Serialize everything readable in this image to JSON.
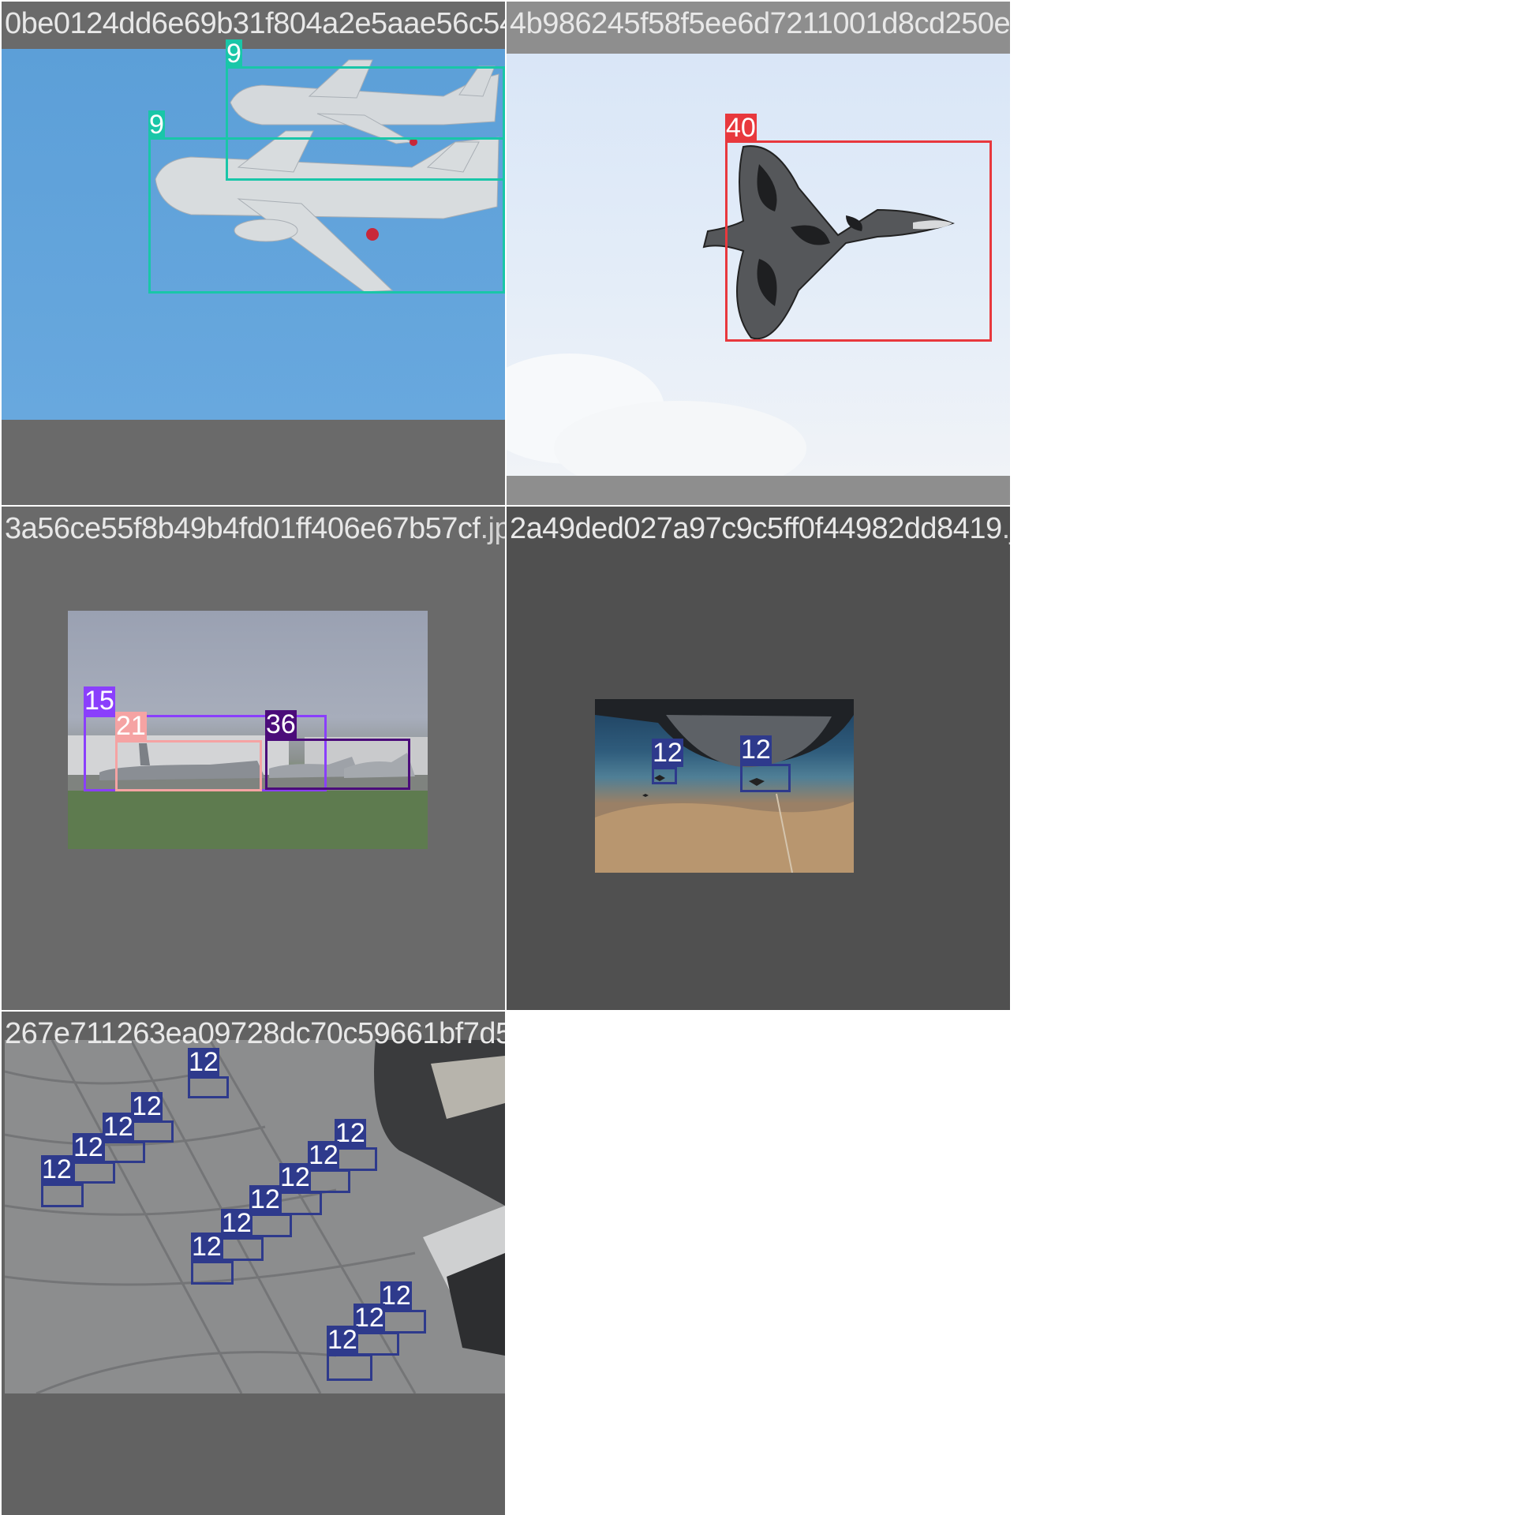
{
  "tiles": [
    {
      "filename": "0be0124dd6e69b31f804a2e5aae56c54.jpg",
      "boxes": [
        {
          "label": "9",
          "color": "#19c6a8"
        },
        {
          "label": "9",
          "color": "#19c6a8"
        }
      ]
    },
    {
      "filename": "4b986245f58f5ee6d7211001d8cd250e.jpg",
      "boxes": [
        {
          "label": "40",
          "color": "#e8383d"
        }
      ]
    },
    {
      "filename": "3a56ce55f8b49b4fd01ff406e67b57cf.jpg",
      "boxes": [
        {
          "label": "15",
          "color": "#8a3ffc"
        },
        {
          "label": "21",
          "color": "#f5a3a3"
        },
        {
          "label": "36",
          "color": "#4b0c7a"
        },
        {
          "label": "36",
          "color": "#4b0c7a"
        }
      ]
    },
    {
      "filename": "2a49ded027a97c9c5ff0f44982dd8419.jpg",
      "boxes": [
        {
          "label": "12",
          "color": "#2e3a8c"
        },
        {
          "label": "12",
          "color": "#2e3a8c"
        }
      ]
    },
    {
      "filename": "267e711263ea09728dc70c59661bf7d5.jpg",
      "boxes": [
        {
          "label": "12",
          "color": "#2e3a8c"
        },
        {
          "label": "12",
          "color": "#2e3a8c"
        },
        {
          "label": "12",
          "color": "#2e3a8c"
        },
        {
          "label": "12",
          "color": "#2e3a8c"
        },
        {
          "label": "12",
          "color": "#2e3a8c"
        },
        {
          "label": "12",
          "color": "#2e3a8c"
        },
        {
          "label": "12",
          "color": "#2e3a8c"
        },
        {
          "label": "12",
          "color": "#2e3a8c"
        },
        {
          "label": "12",
          "color": "#2e3a8c"
        },
        {
          "label": "12",
          "color": "#2e3a8c"
        },
        {
          "label": "12",
          "color": "#2e3a8c"
        },
        {
          "label": "12",
          "color": "#2e3a8c"
        },
        {
          "label": "12",
          "color": "#2e3a8c"
        },
        {
          "label": "12",
          "color": "#2e3a8c"
        }
      ]
    }
  ]
}
